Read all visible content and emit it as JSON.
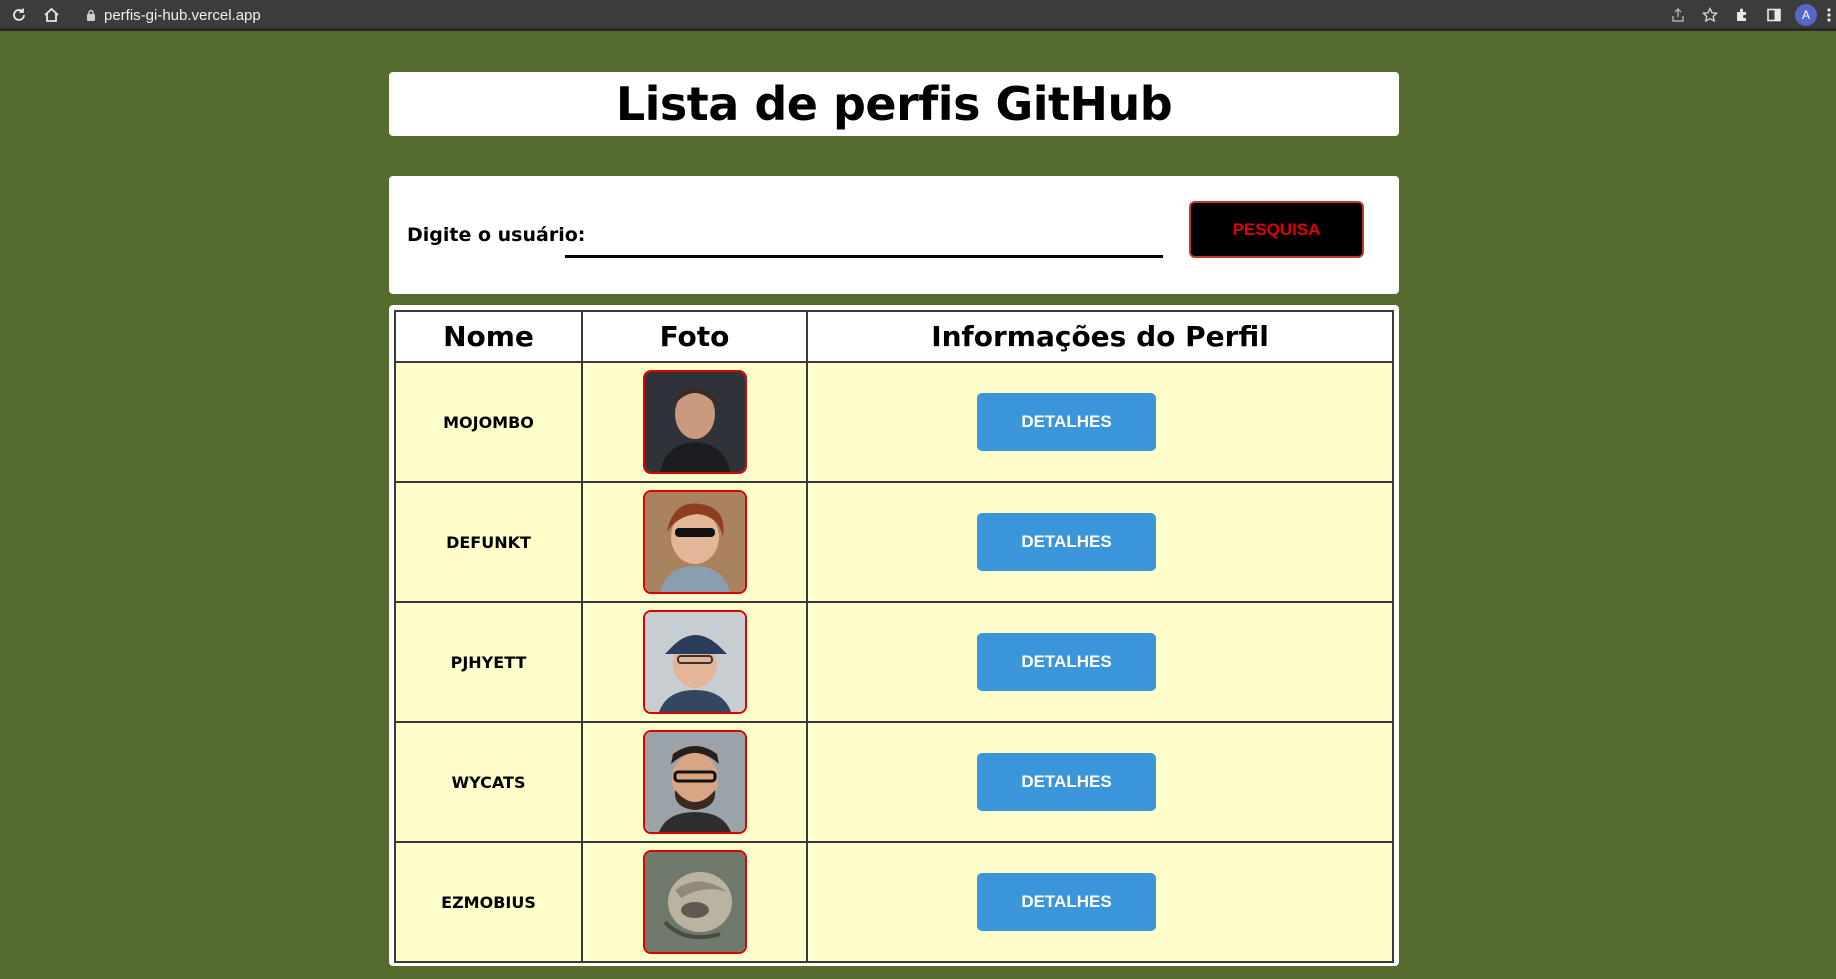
{
  "browser": {
    "url": "perfis-gi-hub.vercel.app",
    "profile_initial": "A"
  },
  "header": {
    "title": "Lista de perfis GitHub"
  },
  "search": {
    "label": "Digite o usuário:",
    "value": "",
    "button_label": "PESQUISA"
  },
  "table": {
    "headers": [
      "Nome",
      "Foto",
      "Informações do Perfil"
    ],
    "rows": [
      {
        "name": "MOJOMBO",
        "details_label": "DETALHES"
      },
      {
        "name": "DEFUNKT",
        "details_label": "DETALHES"
      },
      {
        "name": "PJHYETT",
        "details_label": "DETALHES"
      },
      {
        "name": "WYCATS",
        "details_label": "DETALHES"
      },
      {
        "name": "EZMOBIUS",
        "details_label": "DETALHES"
      }
    ]
  },
  "colors": {
    "background": "#556b2f",
    "row_background": "#ffffcc",
    "details_button": "#3a96d9",
    "search_button_text": "#e00000",
    "avatar_border": "#e00000"
  },
  "icons": [
    "reload-icon",
    "home-icon",
    "lock-icon",
    "share-icon",
    "star-icon",
    "extensions-icon",
    "sidebar-icon",
    "more-icon"
  ]
}
